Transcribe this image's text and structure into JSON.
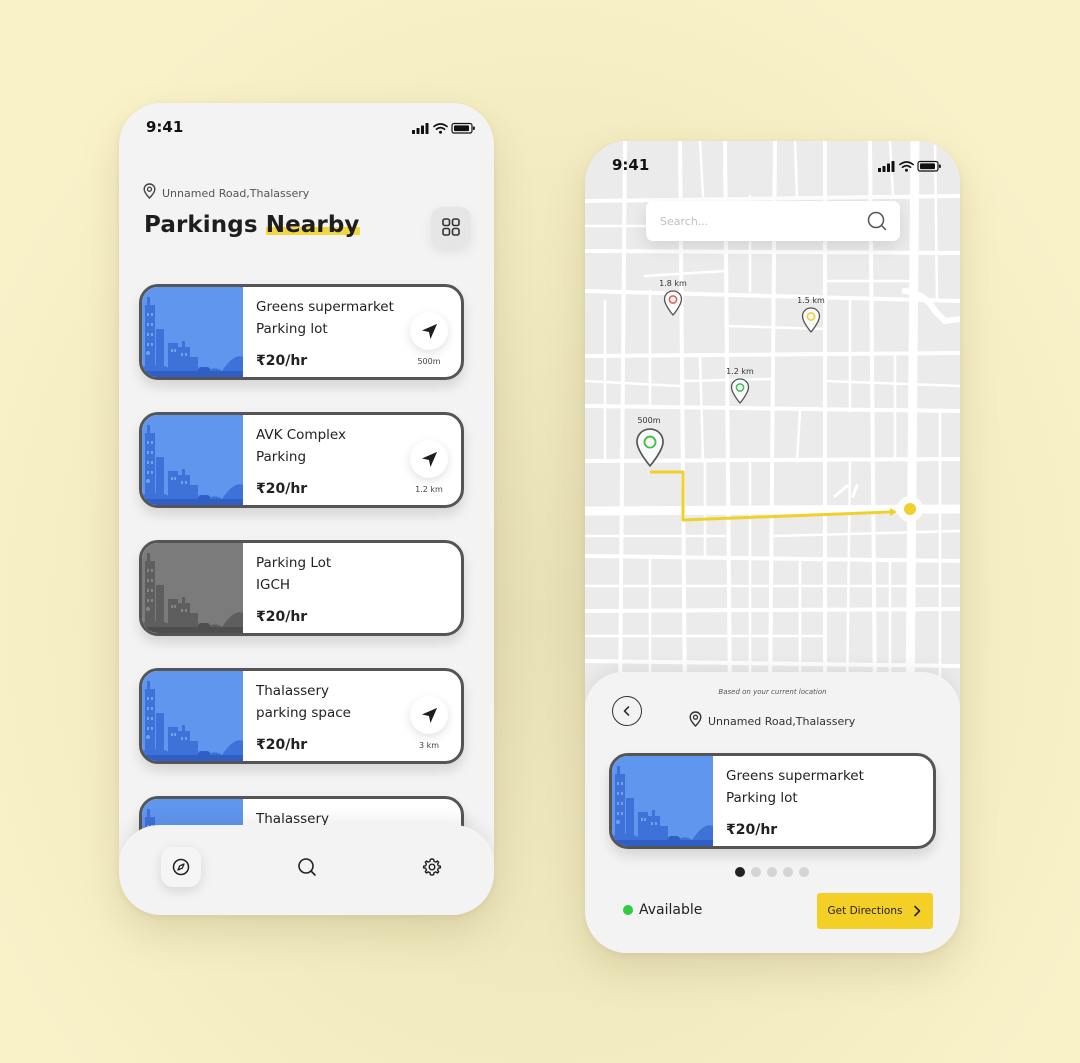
{
  "status_bar": {
    "time": "9:41"
  },
  "list_screen": {
    "location": "Unnamed Road,Thalassery",
    "title_part1": "Parkings",
    "title_part2": "Nearby",
    "cards": [
      {
        "name_line1": "Greens supermarket",
        "name_line2": "Parking lot",
        "price": "₹20/hr",
        "distance": "500m",
        "available": true
      },
      {
        "name_line1": "AVK Complex",
        "name_line2": "Parking",
        "price": "₹20/hr",
        "distance": "1.2 km",
        "available": true
      },
      {
        "name_line1": "Parking Lot",
        "name_line2": "IGCH",
        "price": "₹20/hr",
        "distance": "",
        "available": false
      },
      {
        "name_line1": "Thalassery",
        "name_line2": "parking space",
        "price": "₹20/hr",
        "distance": "3 km",
        "available": true
      },
      {
        "name_line1": "Thalassery",
        "name_line2": "",
        "price": "",
        "distance": "",
        "available": true
      }
    ],
    "bottom_nav": {
      "items": [
        {
          "icon": "compass-icon",
          "active": true
        },
        {
          "icon": "search-icon",
          "active": false
        },
        {
          "icon": "gear-icon",
          "active": false
        }
      ]
    }
  },
  "map_screen": {
    "search": {
      "placeholder": "Search..."
    },
    "pins": [
      {
        "label": "1.8 km",
        "color": "#e35d4f"
      },
      {
        "label": "1.5 km",
        "color": "#f0d02a"
      },
      {
        "label": "1.2 km",
        "color": "#3cc24a"
      },
      {
        "label": "500m",
        "color": "#3cc24a"
      }
    ],
    "route_color": "#f0d02a",
    "sheet": {
      "hint": "Based on your current location",
      "location": "Unnamed Road,Thalassery",
      "card": {
        "name_line1": "Greens supermarket",
        "name_line2": "Parking lot",
        "price": "₹20/hr"
      },
      "page_count": 5,
      "active_page": 1,
      "status": "Available",
      "status_color": "#2ecc40",
      "button_label": "Get Directions"
    }
  },
  "colors": {
    "accent": "#f4d027",
    "card_blue": "#5b8def",
    "card_border": "#555555",
    "background": "#f9f1c8"
  }
}
